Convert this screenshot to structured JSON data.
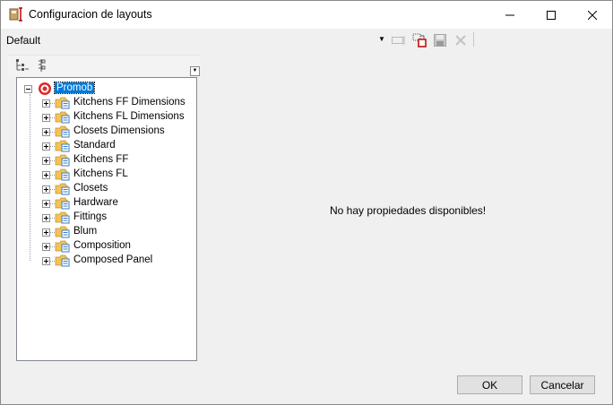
{
  "window": {
    "title": "Configuracion de layouts"
  },
  "layout_selector": {
    "value": "Default"
  },
  "tree": {
    "root": {
      "label": "Promob",
      "expanded": true,
      "selected": true
    },
    "children": [
      {
        "label": "Kitchens FF Dimensions"
      },
      {
        "label": "Kitchens FL Dimensions"
      },
      {
        "label": "Closets Dimensions"
      },
      {
        "label": "Standard"
      },
      {
        "label": "Kitchens FF"
      },
      {
        "label": "Kitchens FL"
      },
      {
        "label": "Closets"
      },
      {
        "label": "Hardware"
      },
      {
        "label": "Fittings"
      },
      {
        "label": "Blum"
      },
      {
        "label": "Composition"
      },
      {
        "label": "Composed Panel"
      }
    ]
  },
  "properties": {
    "empty_message": "No hay propiedades disponibles!"
  },
  "buttons": {
    "ok": "OK",
    "cancel": "Cancelar"
  },
  "colors": {
    "selection": "#0078d7",
    "folder": "#f5c35a",
    "delete_icon": "#d9d9d9"
  }
}
